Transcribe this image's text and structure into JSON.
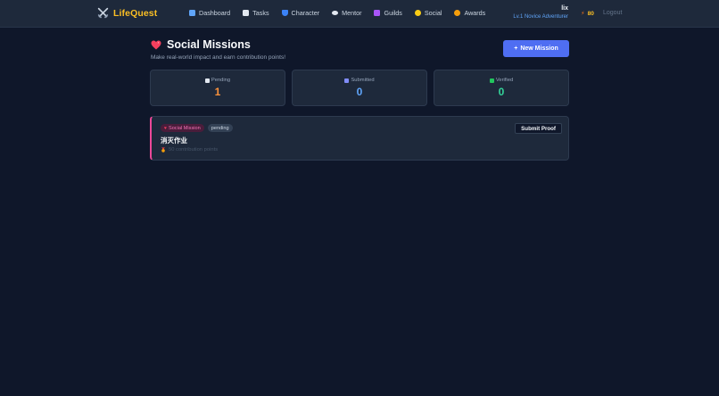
{
  "nav": {
    "brand": "LifeQuest",
    "links": [
      {
        "label": "Dashboard",
        "icon": "chart-icon",
        "color": "#60a5fa"
      },
      {
        "label": "Tasks",
        "icon": "clipboard-icon",
        "color": "#e2e8f0"
      },
      {
        "label": "Character",
        "icon": "shield-icon",
        "color": "#3b82f6"
      },
      {
        "label": "Mentor",
        "icon": "chat-icon",
        "color": "#e2e8f0"
      },
      {
        "label": "Guilds",
        "icon": "castle-icon",
        "color": "#a855f7"
      },
      {
        "label": "Social",
        "icon": "sun-icon",
        "color": "#facc15"
      },
      {
        "label": "Awards",
        "icon": "medal-icon",
        "color": "#f59e0b"
      }
    ],
    "user": {
      "name": "lix",
      "level": "Lv.1 Novice Adventurer"
    },
    "points": "80",
    "logout": "Logout"
  },
  "header": {
    "title": "Social Missions",
    "subtitle": "Make real-world impact and earn contribution points!",
    "new_button": "New Mission"
  },
  "stats": [
    {
      "label": "Pending",
      "value": "1",
      "color": "#fb923c",
      "icon": "clipboard-icon"
    },
    {
      "label": "Submitted",
      "value": "0",
      "color": "#60a5fa",
      "icon": "inbox-icon"
    },
    {
      "label": "Verified",
      "value": "0",
      "color": "#34d399",
      "icon": "check-icon"
    }
  ],
  "missions": [
    {
      "tag": "Social Mission",
      "status": "pending",
      "title": "消灭作业",
      "points": "50 contribution points",
      "action": "Submit Proof"
    }
  ],
  "colors": {
    "background": "#0f172a",
    "surface": "#1e293b",
    "accent": "#4f6ef2",
    "brand": "#fbbf24",
    "mission_border": "#ec4899"
  }
}
